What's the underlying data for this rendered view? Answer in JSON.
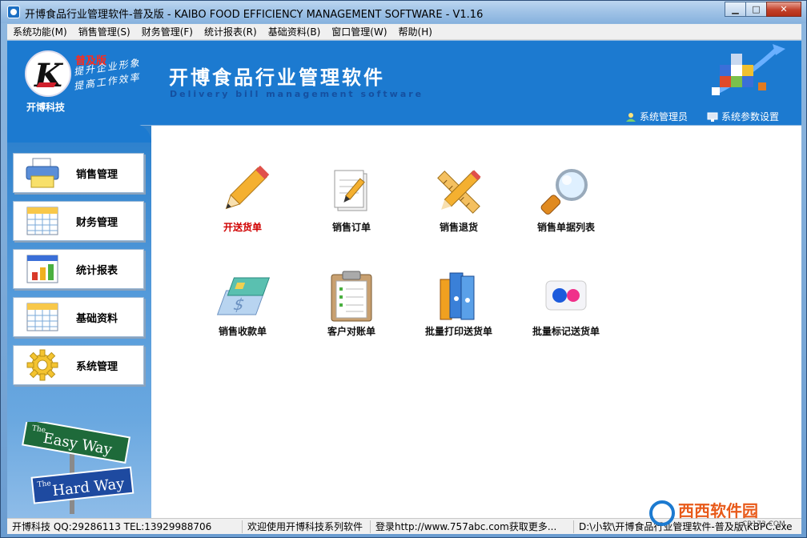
{
  "window": {
    "title": "开博食品行业管理软件-普及版 - KAIBO FOOD EFFICIENCY MANAGEMENT SOFTWARE - V1.16",
    "minimize": "▁",
    "maximize": "□",
    "close": "✕"
  },
  "menu": [
    {
      "label": "系统功能(M)"
    },
    {
      "label": "销售管理(S)"
    },
    {
      "label": "财务管理(F)"
    },
    {
      "label": "统计报表(R)"
    },
    {
      "label": "基础资料(B)"
    },
    {
      "label": "窗口管理(W)"
    },
    {
      "label": "帮助(H)"
    }
  ],
  "header": {
    "logo_letter": "K",
    "edition": "普及版",
    "slogan_line1": "提升企业形象",
    "slogan_line2": "提高工作效率",
    "company": "开博科技",
    "app_title": "开博食品行业管理软件",
    "app_subtitle": "Delivery bill management software",
    "user_link": "系统管理员",
    "settings_link": "系统参数设置"
  },
  "sidebar": {
    "items": [
      {
        "label": "销售管理",
        "icon": "printer-icon"
      },
      {
        "label": "财务管理",
        "icon": "calendar-icon"
      },
      {
        "label": "统计报表",
        "icon": "bar-chart-icon"
      },
      {
        "label": "基础资料",
        "icon": "calendar-icon"
      },
      {
        "label": "系统管理",
        "icon": "gear-icon"
      }
    ],
    "sign_top": "Easy Way",
    "sign_top_prefix": "The",
    "sign_bottom": "Hard Way",
    "sign_bottom_prefix": "The"
  },
  "tiles": [
    {
      "label": "开送货单",
      "icon": "pencil-icon",
      "active": true
    },
    {
      "label": "销售订单",
      "icon": "document-pencil-icon",
      "active": false
    },
    {
      "label": "销售退货",
      "icon": "ruler-pencil-icon",
      "active": false
    },
    {
      "label": "销售单据列表",
      "icon": "magnifier-icon",
      "active": false
    },
    {
      "label": "销售收款单",
      "icon": "payment-card-icon",
      "active": false
    },
    {
      "label": "客户对账单",
      "icon": "clipboard-icon",
      "active": false
    },
    {
      "label": "批量打印送货单",
      "icon": "binders-icon",
      "active": false
    },
    {
      "label": "批量标记送货单",
      "icon": "dots-icon",
      "active": false
    }
  ],
  "status": {
    "contact": "开博科技 QQ:29286113 TEL:13929988706",
    "welcome": "欢迎使用开博科技系列软件",
    "website": "登录http://www.757abc.com获取更多...",
    "path": "D:\\小软\\开博食品行业管理软件-普及版\\KBPC.exe"
  },
  "watermark": {
    "text": "西西软件园",
    "sub": "CR173.COM"
  },
  "colors": {
    "header_blue": "#1c7ad0",
    "active_tile_red": "#d00000",
    "edition_red": "#ff2a1a"
  }
}
